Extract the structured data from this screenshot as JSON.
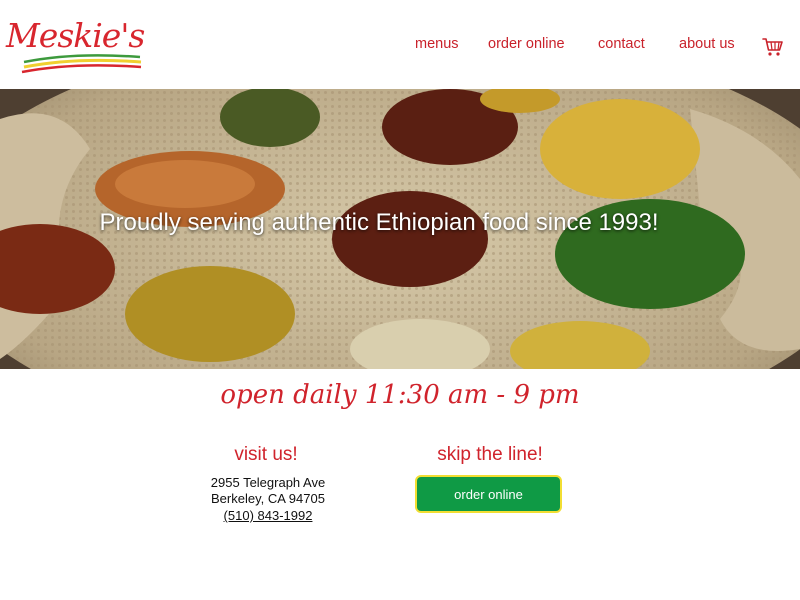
{
  "brand": {
    "logo_text": "Meskie's"
  },
  "nav": {
    "items": [
      "menus",
      "order online",
      "contact",
      "about us"
    ],
    "cart_icon": "cart-icon"
  },
  "hero": {
    "tagline": "Proudly serving authentic Ethiopian food since 1993!"
  },
  "hours": {
    "text": "open daily 11:30 am - 9 pm"
  },
  "visit": {
    "title": "visit us!",
    "address_line1": "2955 Telegraph Ave",
    "address_line2": "Berkeley, CA 94705",
    "phone": "(510) 843-1992"
  },
  "order": {
    "title": "skip the line!",
    "button_label": "order online"
  },
  "colors": {
    "brand_red": "#d0232c",
    "button_green": "#0f9a45",
    "button_border": "#f2de32",
    "logo_stripe_green": "#3d9a3d",
    "logo_stripe_yellow": "#f0d030"
  }
}
